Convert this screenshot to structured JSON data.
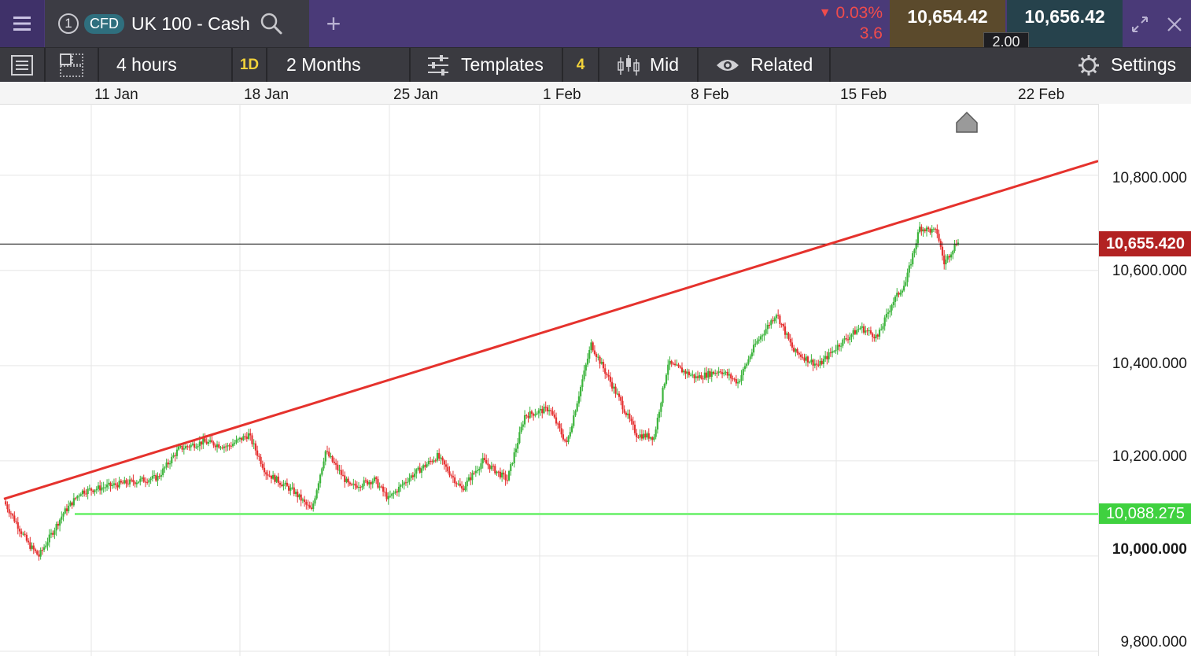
{
  "header": {
    "menu_icon": "hamburger-icon",
    "tab_number": "1",
    "cfd_badge": "CFD",
    "instrument": "UK 100 - Cash",
    "search_icon": "search-icon",
    "add_icon": "plus-icon",
    "change_pct": "0.03%",
    "change_abs": "3.6",
    "sell_price": "10,654.42",
    "buy_price": "10,656.42",
    "spread": "2.00",
    "expand_icon": "expand-icon",
    "close_icon": "close-icon",
    "colors": {
      "header_bg": "#4a3a78",
      "down": "#f04c4c",
      "sell_bg": "#5b4a2c",
      "buy_bg": "#26424c"
    }
  },
  "toolbar": {
    "list_icon": "list-icon",
    "layout_icon": "layout-icon",
    "interval": "4 hours",
    "period_badge": "1D",
    "range": "2 Months",
    "templates_label": "Templates",
    "templates_icon": "sliders-icon",
    "indicator_count": "4",
    "price_type": "Mid",
    "price_type_icon": "candles-icon",
    "related_label": "Related",
    "related_icon": "eye-icon",
    "settings_label": "Settings",
    "settings_icon": "gear-icon"
  },
  "chart_data": {
    "type": "candlestick",
    "title": "",
    "xlabel": "",
    "ylabel": "",
    "x_ticks": [
      "11 Jan",
      "18 Jan",
      "25 Jan",
      "1 Feb",
      "8 Feb",
      "15 Feb",
      "22 Feb"
    ],
    "y_ticks": [
      "10,800.000",
      "10,600.000",
      "10,400.000",
      "10,200.000",
      "10,000.000",
      "9,800.000"
    ],
    "y_tick_values": [
      10800,
      10600,
      10400,
      10200,
      10000,
      9800
    ],
    "ylim": [
      9790,
      10950
    ],
    "grid": true,
    "up_color": "#3cb43c",
    "down_color": "#e53030",
    "current_price": {
      "label": "10,655.420",
      "value": 10655.42,
      "color": "#b22222"
    },
    "support_line": {
      "label": "10,088.275",
      "value": 10088.275,
      "color": "#7ef27e"
    },
    "trend_line": {
      "color": "#e5322d",
      "start": [
        "7 Jan",
        10120
      ],
      "end": [
        "25 Feb",
        10830
      ]
    },
    "series_path": [
      [
        0,
        10115
      ],
      [
        14,
        10025
      ],
      [
        20,
        10000
      ],
      [
        34,
        10090
      ],
      [
        44,
        10135
      ],
      [
        64,
        10150
      ],
      [
        88,
        10165
      ],
      [
        100,
        10225
      ],
      [
        114,
        10240
      ],
      [
        128,
        10230
      ],
      [
        140,
        10255
      ],
      [
        150,
        10175
      ],
      [
        166,
        10135
      ],
      [
        176,
        10095
      ],
      [
        184,
        10220
      ],
      [
        198,
        10145
      ],
      [
        212,
        10160
      ],
      [
        220,
        10120
      ],
      [
        232,
        10165
      ],
      [
        248,
        10210
      ],
      [
        262,
        10140
      ],
      [
        274,
        10200
      ],
      [
        288,
        10160
      ],
      [
        298,
        10295
      ],
      [
        312,
        10310
      ],
      [
        322,
        10235
      ],
      [
        336,
        10445
      ],
      [
        352,
        10330
      ],
      [
        362,
        10255
      ],
      [
        372,
        10250
      ],
      [
        380,
        10405
      ],
      [
        396,
        10375
      ],
      [
        410,
        10390
      ],
      [
        420,
        10365
      ],
      [
        430,
        10445
      ],
      [
        442,
        10510
      ],
      [
        452,
        10430
      ],
      [
        466,
        10400
      ],
      [
        478,
        10445
      ],
      [
        490,
        10480
      ],
      [
        500,
        10460
      ],
      [
        508,
        10530
      ],
      [
        516,
        10575
      ],
      [
        524,
        10690
      ],
      [
        534,
        10680
      ],
      [
        538,
        10615
      ],
      [
        546,
        10665
      ]
    ]
  }
}
